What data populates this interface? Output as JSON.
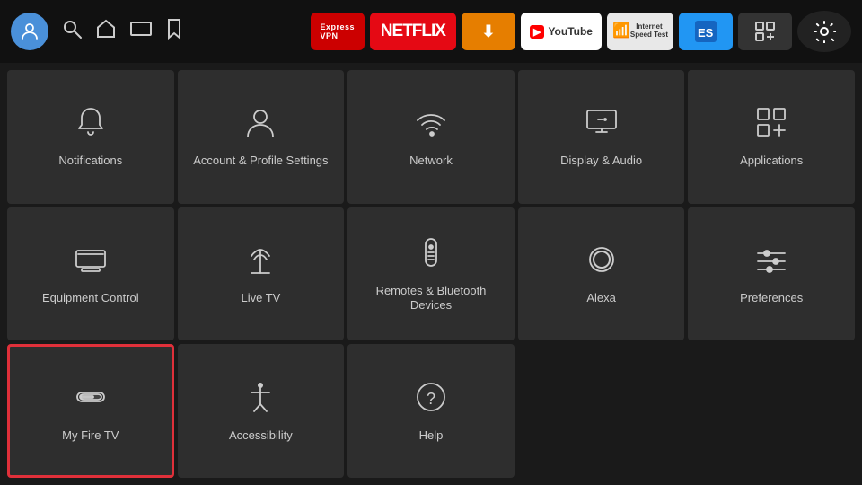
{
  "nav": {
    "avatar_icon": "👤",
    "search_icon": "🔍",
    "home_icon": "🏠",
    "tv_icon": "📺",
    "bookmark_icon": "🔖",
    "apps": [
      {
        "label": "ExpressVPN",
        "class": "chip-express",
        "name": "expressvpn-chip"
      },
      {
        "label": "NETFLIX",
        "class": "chip-netflix",
        "name": "netflix-chip"
      },
      {
        "label": "⬇ Downloader",
        "class": "chip-downloader",
        "name": "downloader-chip"
      },
      {
        "label": "▶ YouTube",
        "class": "chip-youtube",
        "name": "youtube-chip"
      },
      {
        "label": "Internet Speed Test",
        "class": "chip-speed",
        "name": "speedtest-chip"
      },
      {
        "label": "ES",
        "class": "chip-es",
        "name": "es-chip"
      },
      {
        "label": "⊞+",
        "class": "chip-add",
        "name": "add-app-chip"
      }
    ],
    "settings_icon": "⚙"
  },
  "tiles": [
    {
      "id": "notifications",
      "label": "Notifications",
      "icon": "bell",
      "selected": false
    },
    {
      "id": "account-profile",
      "label": "Account & Profile Settings",
      "icon": "person",
      "selected": false
    },
    {
      "id": "network",
      "label": "Network",
      "icon": "wifi",
      "selected": false
    },
    {
      "id": "display-audio",
      "label": "Display & Audio",
      "icon": "display",
      "selected": false
    },
    {
      "id": "applications",
      "label": "Applications",
      "icon": "apps",
      "selected": false
    },
    {
      "id": "equipment-control",
      "label": "Equipment Control",
      "icon": "monitor",
      "selected": false
    },
    {
      "id": "live-tv",
      "label": "Live TV",
      "icon": "antenna",
      "selected": false
    },
    {
      "id": "remotes-bluetooth",
      "label": "Remotes & Bluetooth Devices",
      "icon": "remote",
      "selected": false
    },
    {
      "id": "alexa",
      "label": "Alexa",
      "icon": "alexa",
      "selected": false
    },
    {
      "id": "preferences",
      "label": "Preferences",
      "icon": "sliders",
      "selected": false
    },
    {
      "id": "my-fire-tv",
      "label": "My Fire TV",
      "icon": "firetv",
      "selected": true
    },
    {
      "id": "accessibility",
      "label": "Accessibility",
      "icon": "accessibility",
      "selected": false
    },
    {
      "id": "help",
      "label": "Help",
      "icon": "help",
      "selected": false
    }
  ]
}
